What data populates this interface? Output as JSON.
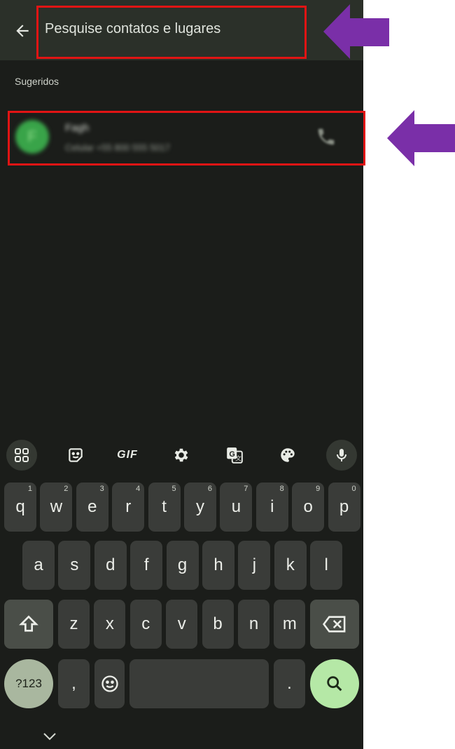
{
  "search": {
    "placeholder": "Pesquise contatos e lugares"
  },
  "section_label": "Sugeridos",
  "contact": {
    "avatar_letter": "F",
    "name": "Fagh",
    "phone": "Celular +55 800 555 5017"
  },
  "keyboard": {
    "toolbar": {
      "gif_label": "GIF"
    },
    "row1": [
      {
        "k": "q",
        "n": "1"
      },
      {
        "k": "w",
        "n": "2"
      },
      {
        "k": "e",
        "n": "3"
      },
      {
        "k": "r",
        "n": "4"
      },
      {
        "k": "t",
        "n": "5"
      },
      {
        "k": "y",
        "n": "6"
      },
      {
        "k": "u",
        "n": "7"
      },
      {
        "k": "i",
        "n": "8"
      },
      {
        "k": "o",
        "n": "9"
      },
      {
        "k": "p",
        "n": "0"
      }
    ],
    "row2": [
      "a",
      "s",
      "d",
      "f",
      "g",
      "h",
      "j",
      "k",
      "l"
    ],
    "row3": [
      "z",
      "x",
      "c",
      "v",
      "b",
      "n",
      "m"
    ],
    "symbols_label": "?123",
    "comma_label": ",",
    "period_label": "."
  },
  "colors": {
    "annotation_box": "#e11414",
    "annotation_arrow": "#7a2fa8",
    "accent": "#b5e8a6"
  }
}
